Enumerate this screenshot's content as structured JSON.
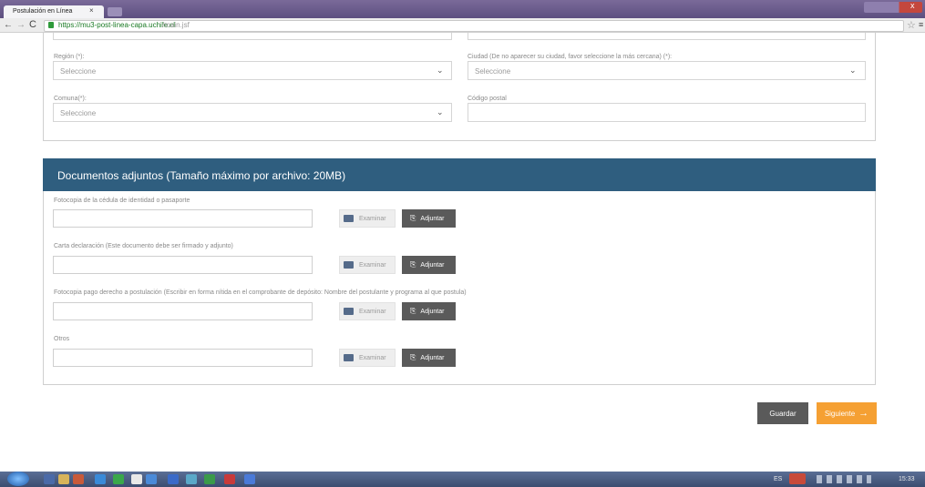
{
  "browser": {
    "tab_title": "Postulación en Línea",
    "tab_close": "×",
    "url_host": "https://mu3-post-linea-capa.uchile.cl",
    "url_path": "/main.jsf",
    "back_glyph": "←",
    "forward_glyph": "→",
    "reload_glyph": "C",
    "star_glyph": "☆",
    "menu_glyph": "≡",
    "close_glyph": "x"
  },
  "address_section": {
    "region": {
      "label": "Región (*):",
      "placeholder": "Seleccione"
    },
    "ciudad": {
      "label": "Ciudad (De no aparecer su ciudad, favor seleccione la más cercana) (*):",
      "placeholder": "Seleccione"
    },
    "comuna": {
      "label": "Comuna(*):",
      "placeholder": "Seleccione"
    },
    "codigo_postal": {
      "label": "Código postal",
      "value": ""
    }
  },
  "documents": {
    "title": "Documentos adjuntos (Tamaño máximo por archivo: 20MB)",
    "examinar_label": "Examinar",
    "adjuntar_label": "Adjuntar",
    "items": [
      {
        "label": "Fotocopia de la cédula de identidad o pasaporte"
      },
      {
        "label": "Carta declaración (Este documento debe ser firmado y adjunto)"
      },
      {
        "label": "Fotocopia pago derecho a postulación (Escribir en forma nítida en el comprobante de depósito: Nombre del postulante y programa al que postula)"
      },
      {
        "label": "Otros"
      }
    ]
  },
  "actions": {
    "guardar": "Guardar",
    "siguiente": "Siguiente",
    "siguiente_arrow": "→"
  },
  "taskbar": {
    "language": "ES",
    "time": "15:33"
  },
  "icons": {
    "chevron": "chevron-down-icon",
    "folder": "folder-icon",
    "clip": "paperclip-icon",
    "lock": "lock-icon"
  }
}
